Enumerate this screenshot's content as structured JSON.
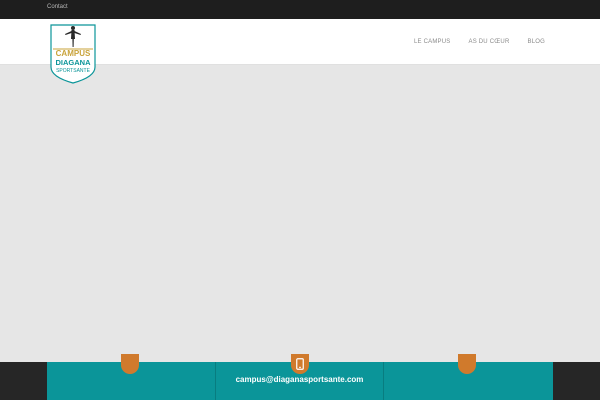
{
  "topbar": {
    "contact_label": "Contact"
  },
  "logo": {
    "line1": "CAMPUS",
    "line2": "DIAGANA",
    "line3": "SPORTSANTE"
  },
  "nav": {
    "items": [
      {
        "label": "LE CAMPUS"
      },
      {
        "label": "AS DU CŒUR"
      },
      {
        "label": "BLOG"
      }
    ]
  },
  "footer": {
    "email": "campus@diaganasportsante.com",
    "icons": [
      "map-pin-icon",
      "phone-icon",
      "clock-icon"
    ]
  },
  "colors": {
    "topbar": "#1e1e1e",
    "accent_teal": "#0b9599",
    "accent_orange": "#d07a2c",
    "logo_gold": "#c9a33a"
  }
}
